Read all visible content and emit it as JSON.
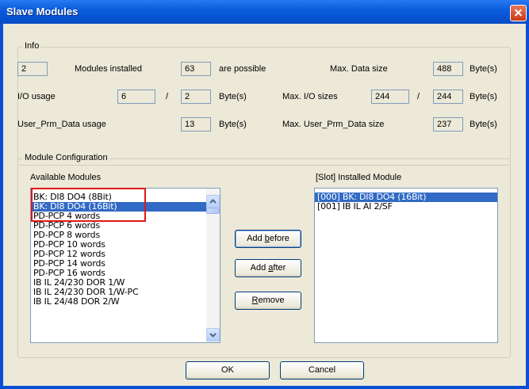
{
  "window": {
    "title": "Slave Modules"
  },
  "info": {
    "legend": "Info",
    "modules_installed_value": "2",
    "modules_installed_label": "Modules installed",
    "possible_value": "63",
    "possible_label": "are possible",
    "max_data_size_label": "Max. Data size",
    "max_data_size_value": "488",
    "bytes_unit": "Byte(s)",
    "io_usage_label": "I/O usage",
    "io_usage_in": "6",
    "slash": "/",
    "io_usage_out": "2",
    "max_io_sizes_label": "Max. I/O sizes",
    "max_io_in": "244",
    "max_io_out": "244",
    "prm_usage_label": "User_Prm_Data usage",
    "prm_usage_value": "13",
    "max_prm_label": "Max. User_Prm_Data size",
    "max_prm_value": "237"
  },
  "module_config": {
    "legend": "Module Configuration",
    "available_label": "Available Modules",
    "installed_label": "[Slot] Installed Module",
    "available_items": [
      "BK: DI8 DO4 (8Bit)",
      "BK: DI8 DO4 (16Bit)",
      "PD-PCP 4 words",
      "PD-PCP 6 words",
      "PD-PCP 8 words",
      "PD-PCP 10 words",
      "PD-PCP 12 words",
      "PD-PCP 14 words",
      "PD-PCP 16 words",
      "IB IL 24/230 DOR 1/W",
      "IB IL 24/230 DOR 1/W-PC",
      "IB IL 24/48 DOR 2/W"
    ],
    "installed_items": [
      "[000] BK: DI8 DO4 (16Bit)",
      "[001] IB IL AI 2/SF"
    ],
    "add_before": {
      "pre": "Add ",
      "key": "b",
      "post": "efore"
    },
    "add_after": {
      "pre": "Add ",
      "key": "a",
      "post": "fter"
    },
    "remove": {
      "pre": "",
      "key": "R",
      "post": "emove"
    }
  },
  "footer": {
    "ok": "OK",
    "cancel": "Cancel"
  }
}
